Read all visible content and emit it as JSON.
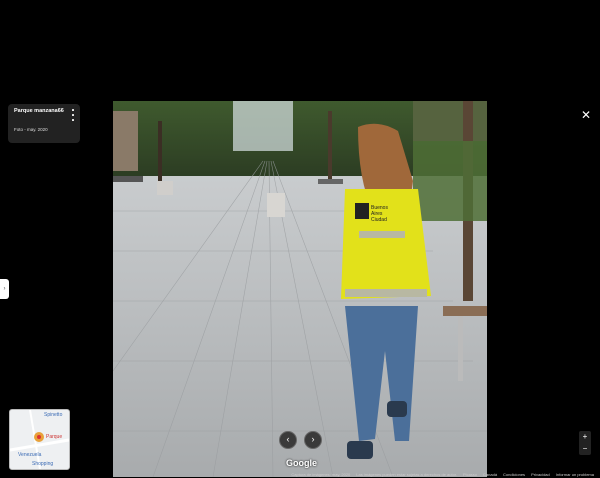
{
  "place": {
    "title": "Parque manzana66",
    "photo_date": "Foto - may. 2020"
  },
  "vest_text": [
    "Buenos",
    "Aires",
    "Ciudad"
  ],
  "minimap": {
    "labels": [
      "Spinetto",
      "Parque",
      "Venezuela",
      "Shopping"
    ]
  },
  "branding": {
    "logo": "Google"
  },
  "footer": {
    "capture": "Captura de imágenes: may. 2020",
    "rights": "Las imágenes pueden estar sujetas a derechos de autor.",
    "picasso": "Picasso",
    "country": "Canadá",
    "terms": "Condiciones",
    "privacy": "Privacidad",
    "report": "Informar un problema"
  },
  "controls": {
    "close": "✕",
    "prev": "‹",
    "next": "›",
    "zoom_in": "+",
    "zoom_out": "−",
    "side_toggle": "›"
  },
  "icons": {
    "kebab": "more-vert-icon",
    "close": "close-icon",
    "pin": "map-pin-icon"
  }
}
